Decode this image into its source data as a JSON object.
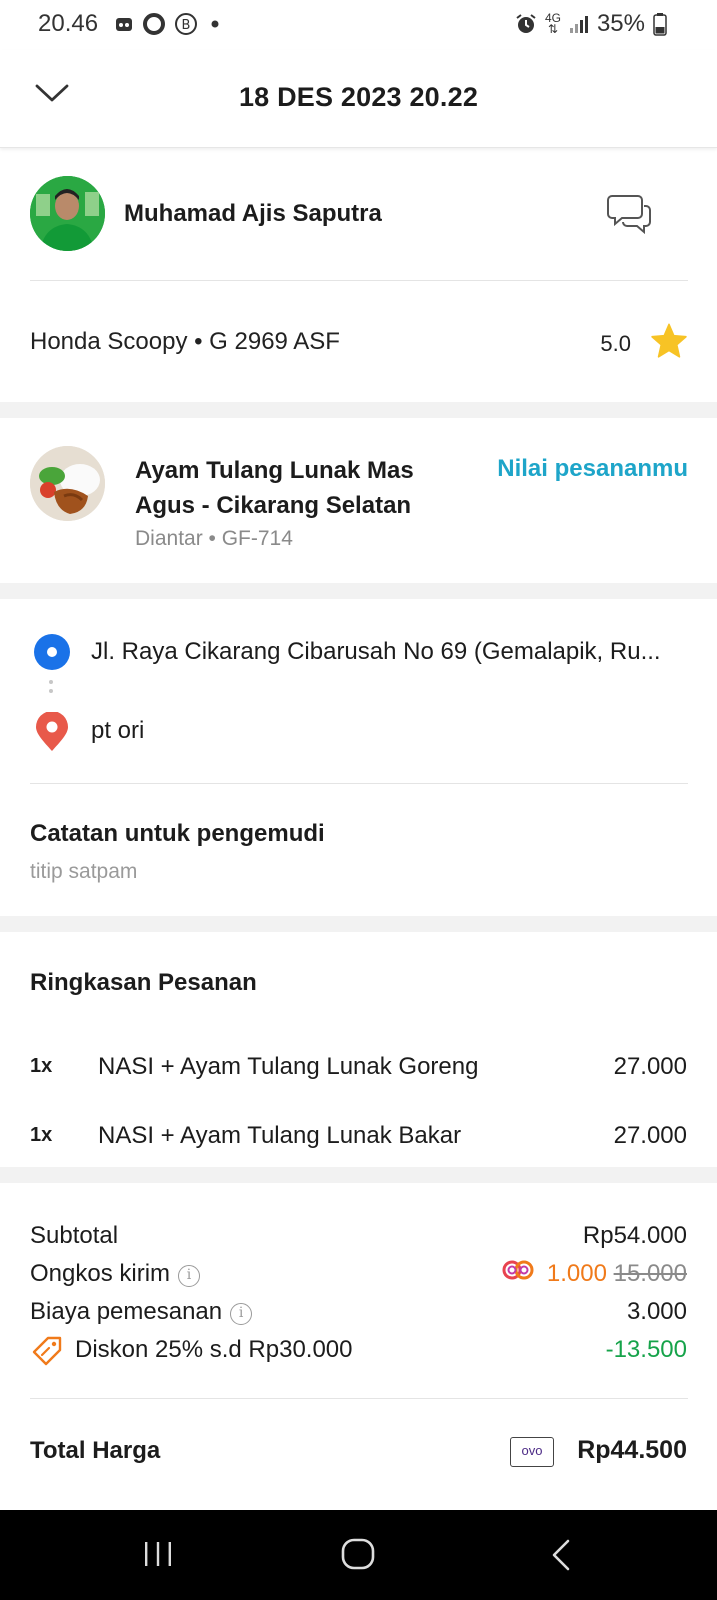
{
  "status_bar": {
    "time": "20.46",
    "network": "4G",
    "battery": "35%",
    "icons": [
      "notification-icon",
      "circle-icon",
      "b-icon",
      "dot-icon",
      "alarm-icon",
      "network-arrows-icon",
      "signal-icon",
      "battery-icon"
    ]
  },
  "header": {
    "title": "18 DES 2023 20.22",
    "back_icon": "chevron-down-icon"
  },
  "driver": {
    "name": "Muhamad Ajis Saputra",
    "vehicle": "Honda Scoopy • G 2969 ASF",
    "rating": "5.0",
    "chat_icon": "chat-bubbles-icon"
  },
  "restaurant": {
    "name": "Ayam Tulang Lunak Mas Agus - Cikarang Selatan",
    "subtitle": "Diantar • GF-714",
    "rate_link": "Nilai pesananmu"
  },
  "route": {
    "origin": "Jl. Raya Cikarang Cibarusah No 69 (Gemalapik, Ru...",
    "destination": "pt ori"
  },
  "note": {
    "title": "Catatan untuk pengemudi",
    "text": "titip satpam"
  },
  "summary": {
    "title": "Ringkasan Pesanan",
    "items": [
      {
        "qty": "1x",
        "name": "NASI + Ayam Tulang Lunak Goreng",
        "price": "27.000"
      },
      {
        "qty": "1x",
        "name": "NASI + Ayam Tulang Lunak Bakar",
        "price": "27.000"
      }
    ]
  },
  "costs": {
    "subtotal_label": "Subtotal",
    "subtotal_value": "Rp54.000",
    "delivery_label": "Ongkos kirim",
    "delivery_value": "1.000",
    "delivery_original": "15.000",
    "booking_label": "Biaya pemesanan",
    "booking_value": "3.000",
    "discount_label": "Diskon 25% s.d Rp30.000",
    "discount_value": "-13.500",
    "total_label": "Total Harga",
    "payment_method": "ovo",
    "total_value": "Rp44.500"
  },
  "colors": {
    "accent_link": "#1ea5c9",
    "origin_dot": "#1a72e8",
    "destination_pin": "#e8594a",
    "star": "#f7c325",
    "promo": "#f07a1a",
    "discount": "#16a34a"
  }
}
